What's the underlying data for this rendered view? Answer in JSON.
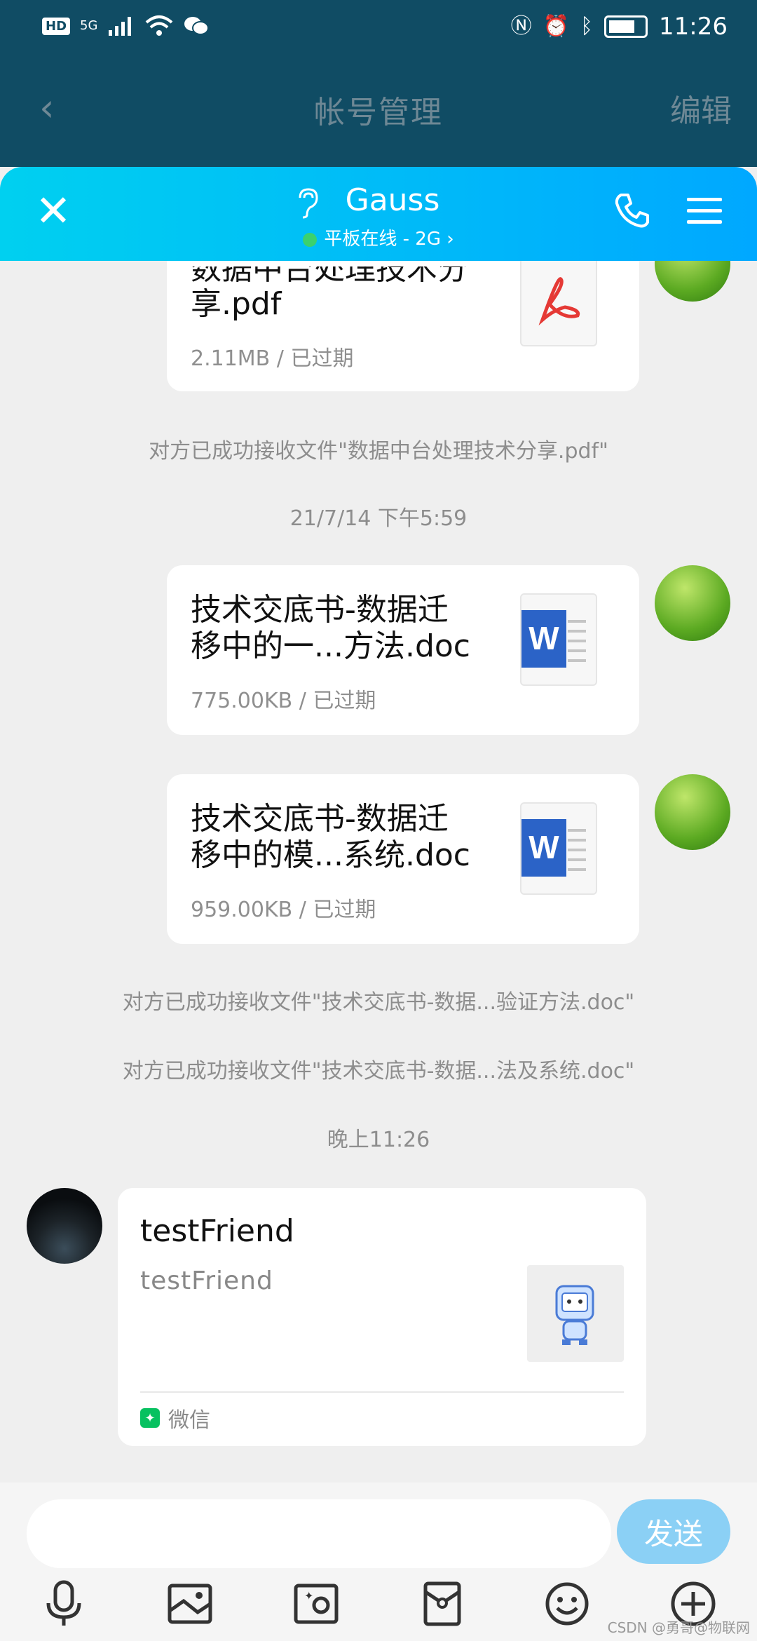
{
  "status_bar": {
    "left_badges": [
      "HD",
      "5G"
    ],
    "time": "11:26"
  },
  "background_page": {
    "title": "帐号管理",
    "edit_label": "编辑"
  },
  "chat": {
    "contact_name": "Gauss",
    "online_status": "平板在线 - 2G",
    "messages": [
      {
        "type": "file",
        "name": "数据中台处理技术分享.pdf",
        "meta": "2.11MB / 已过期",
        "icon": "pdf-icon"
      },
      {
        "type": "system",
        "text": "对方已成功接收文件\"数据中台处理技术分享.pdf\""
      },
      {
        "type": "time",
        "text": "21/7/14 下午5:59"
      },
      {
        "type": "file",
        "name_line1": "技术交底书-数据迁",
        "name_line2": "移中的一...方法.doc",
        "meta": "775.00KB / 已过期",
        "icon": "word-icon"
      },
      {
        "type": "file",
        "name_line1": "技术交底书-数据迁",
        "name_line2": "移中的模...系统.doc",
        "meta": "959.00KB / 已过期",
        "icon": "word-icon"
      },
      {
        "type": "system",
        "text": "对方已成功接收文件\"技术交底书-数据...验证方法.doc\""
      },
      {
        "type": "system",
        "text": "对方已成功接收文件\"技术交底书-数据...法及系统.doc\""
      },
      {
        "type": "time",
        "text": "晚上11:26"
      },
      {
        "type": "link",
        "title": "testFriend",
        "desc": "testFriend",
        "source": "微信"
      }
    ],
    "first_file_line1": "数据中台处理技术分",
    "first_file_line2": "享.pdf"
  },
  "input": {
    "placeholder": "",
    "send_label": "发送"
  },
  "toolbar_icons": [
    "microphone-icon",
    "image-icon",
    "camera-icon",
    "red-packet-icon",
    "emoji-icon",
    "plus-icon"
  ],
  "watermark": "CSDN @勇哥@物联网",
  "colors": {
    "header_gradient_start": "#00d0f0",
    "header_gradient_end": "#00a8ff",
    "send_button": "#8bd0f5",
    "online_dot": "#3bd16f",
    "background_header": "#104c64"
  }
}
